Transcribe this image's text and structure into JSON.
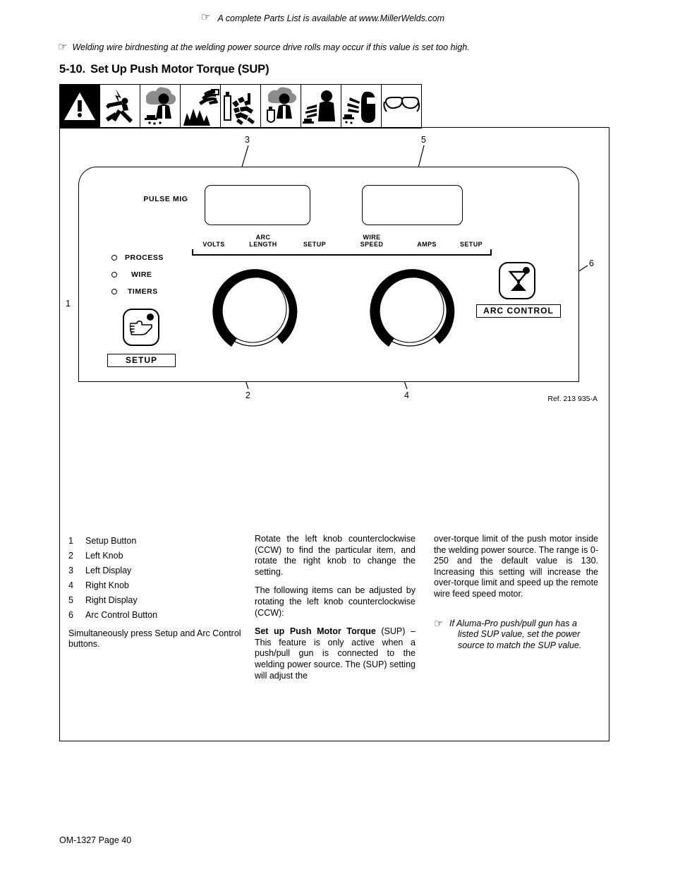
{
  "notes": {
    "parts_list": "A complete Parts List is available at www.MillerWelds.com",
    "birdnesting": "Welding wire birdnesting at the welding power source drive rolls may occur if this value is set too high."
  },
  "section": {
    "number": "5-10.",
    "title": "Set Up Push Motor Torque (SUP)"
  },
  "safety_icons": [
    {
      "name": "warning-triangle-icon"
    },
    {
      "name": "electric-shock-icon"
    },
    {
      "name": "welding-fumes-icon"
    },
    {
      "name": "fire-explosion-icon"
    },
    {
      "name": "flying-sparks-cylinder-icon"
    },
    {
      "name": "gas-cylinder-fumes-icon"
    },
    {
      "name": "arc-rays-burn-icon"
    },
    {
      "name": "arc-rays-helmet-icon"
    },
    {
      "name": "safety-glasses-icon"
    }
  ],
  "panel": {
    "process_label": "PULSE\nMIG",
    "meter_labels_left": [
      "VOLTS",
      "ARC\nLENGTH",
      "SETUP"
    ],
    "meter_labels_right": [
      "WIRE\nSPEED",
      "AMPS",
      "SETUP"
    ],
    "leds": [
      "PROCESS",
      "WIRE",
      "TIMERS"
    ],
    "setup_button_caption": "SETUP",
    "arc_control_caption": "ARC CONTROL",
    "setup_icon": "pointing-hand-icon",
    "arc_control_icon": "hourglass-icon",
    "reference": "Ref. 213 935-A",
    "callouts": [
      "1",
      "2",
      "3",
      "4",
      "5",
      "6"
    ]
  },
  "legend": {
    "items": [
      {
        "num": "1",
        "label": "Setup Button"
      },
      {
        "num": "2",
        "label": "Left Knob"
      },
      {
        "num": "3",
        "label": "Left Display"
      },
      {
        "num": "4",
        "label": "Right Knob"
      },
      {
        "num": "5",
        "label": "Right Display"
      },
      {
        "num": "6",
        "label": "Arc Control Button"
      }
    ],
    "note": "Simultaneously press Setup and Arc Control buttons."
  },
  "body": {
    "para_1": "Rotate the left knob counterclockwise (CCW) to find the particular item, and rotate the right knob to change the setting.",
    "para_2": "The following items can be adjusted by rotating the left knob counterclockwise (CCW):",
    "para_3_bold": "Set up Push Motor Torque",
    "para_3_rest": " (SUP) – This feature is only active when a push/pull gun is connected to the welding power source. The (SUP) setting will adjust the",
    "para_4": "over-torque limit of the push motor inside the welding power source. The range is 0-250 and the default value is 130. Increasing this setting will increase the over-torque limit and speed up the remote wire feed speed motor.",
    "note_line_1": "If Aluma-Pro push/pull gun has a",
    "note_line_2": "listed SUP value, set the power",
    "note_line_3": "source to match the SUP value."
  },
  "footer": {
    "text": "OM-1327 Page 40"
  }
}
